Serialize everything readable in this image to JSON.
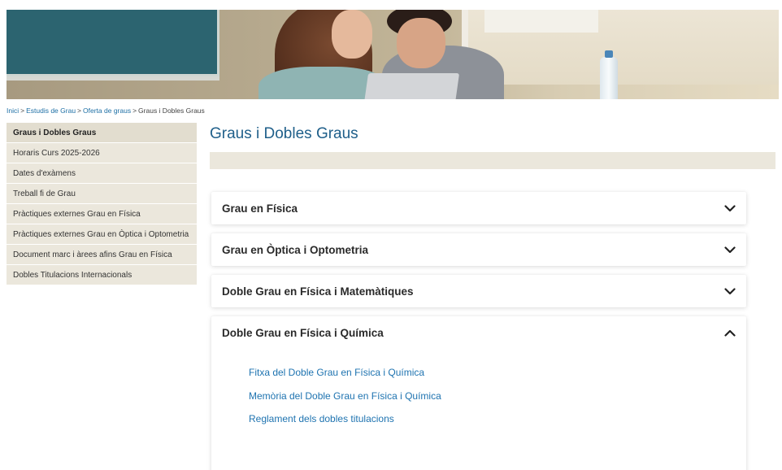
{
  "breadcrumb": {
    "items": [
      {
        "label": "Inici",
        "link": true
      },
      {
        "label": "Estudis de Grau",
        "link": true
      },
      {
        "label": "Oferta de graus",
        "link": true
      },
      {
        "label": "Graus i Dobles Graus",
        "link": false
      }
    ],
    "separator": ">"
  },
  "sidebar": {
    "items": [
      {
        "label": "Graus i Dobles Graus",
        "active": true
      },
      {
        "label": "Horaris Curs 2025-2026"
      },
      {
        "label": "Dates d'exàmens"
      },
      {
        "label": "Treball fi de Grau"
      },
      {
        "label": "Pràctiques externes Grau en Física"
      },
      {
        "label": "Pràctiques externes Grau en Òptica i Optometria"
      },
      {
        "label": "Document marc i àrees afins Grau en Física"
      },
      {
        "label": "Dobles Titulacions Internacionals"
      }
    ]
  },
  "main": {
    "title": "Graus i Dobles Graus",
    "accordion": [
      {
        "title": "Grau en Física",
        "expanded": false,
        "icon": "chevron-down-icon"
      },
      {
        "title": "Grau en Òptica i Optometria",
        "expanded": false,
        "icon": "chevron-down-icon"
      },
      {
        "title": "Doble Grau en Física i Matemàtiques",
        "expanded": false,
        "icon": "chevron-down-icon"
      },
      {
        "title": "Doble Grau en Física i Química",
        "expanded": true,
        "icon": "chevron-up-icon",
        "links": [
          "Fitxa del Doble Grau en Física i Química",
          "Memòria del Doble Grau en Física i Química",
          "Reglament dels dobles titulacions"
        ]
      }
    ]
  },
  "colors": {
    "title_blue": "#1f5f8a",
    "link_blue": "#1e73b0",
    "sidebar_bg": "#ebe7dc"
  }
}
